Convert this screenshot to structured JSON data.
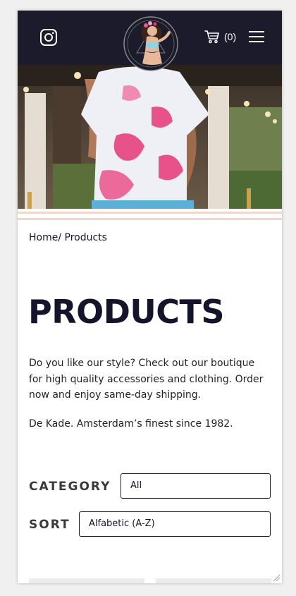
{
  "header": {
    "icons": {
      "instagram": "instagram-icon",
      "logo": "boutique-logo",
      "cart": "cart-icon",
      "menu": "hamburger-menu-icon"
    },
    "cart_count": "(0)"
  },
  "breadcrumb": "Home/ Products",
  "page_title": "PRODUCTS",
  "intro": "Do you like our style? Check out our boutique for high quality accessories and clothing. Order now and enjoy same-day shipping.",
  "tagline": "De Kade. Amsterdam’s finest since 1982.",
  "filters": {
    "category_label": "CATEGORY",
    "category_value": "All",
    "sort_label": "SORT",
    "sort_value": "Alfabetic (A-Z)"
  },
  "colors": {
    "header_bg": "#1b1b2c",
    "accent_stripe": "#f3d6c8",
    "text": "#14142a"
  }
}
